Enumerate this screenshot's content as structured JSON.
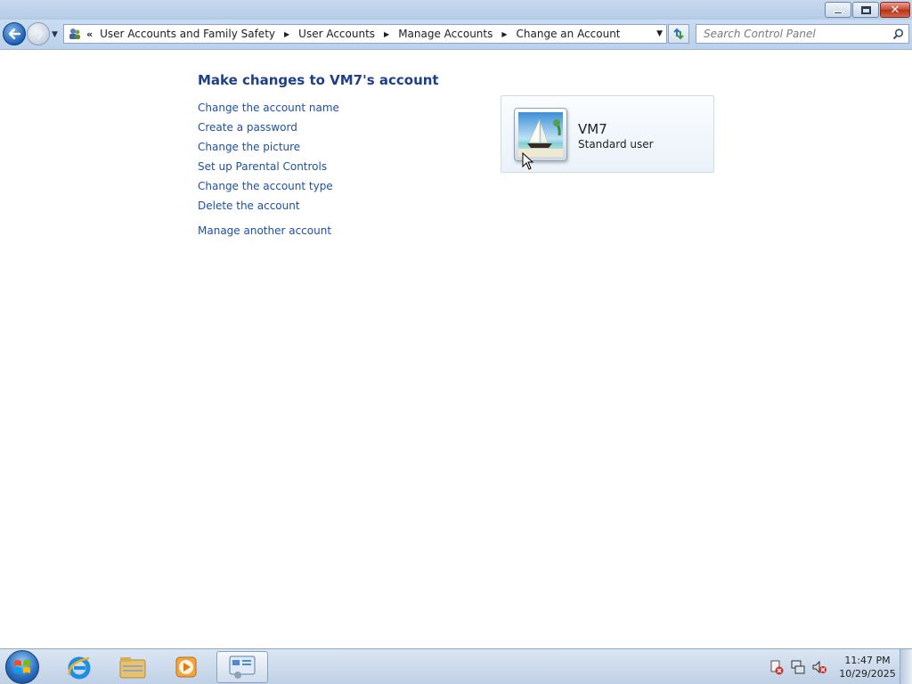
{
  "window": {
    "controls": {
      "minimize_icon": "minimize-icon",
      "maximize_icon": "restore-icon",
      "close_glyph": "✕"
    }
  },
  "navigation": {
    "back_icon": "back-arrow-icon",
    "forward_icon": "forward-arrow-icon",
    "breadcrumb_prefix": "«",
    "breadcrumbs": [
      "User Accounts and Family Safety",
      "User Accounts",
      "Manage Accounts",
      "Change an Account"
    ],
    "search_placeholder": "Search Control Panel"
  },
  "main": {
    "title": "Make changes to VM7's account",
    "tasks": [
      "Change the account name",
      "Create a password",
      "Change the picture",
      "Set up Parental Controls",
      "Change the account type",
      "Delete the account"
    ],
    "manage_another": "Manage another account",
    "account": {
      "name": "VM7",
      "type": "Standard user",
      "picture_icon": "sailboat-picture"
    }
  },
  "taskbar": {
    "pinned": [
      "start-orb",
      "internet-explorer-icon",
      "windows-explorer-icon",
      "media-player-icon",
      "control-panel-icon"
    ],
    "tray": [
      "action-center-error-icon",
      "network-icon",
      "volume-muted-icon"
    ],
    "clock": {
      "time": "11:47 PM",
      "date": "10/29/2025"
    }
  },
  "colors": {
    "link": "#1e50a2",
    "title": "#1e3f8a",
    "chrome": "#c9dcf1"
  }
}
